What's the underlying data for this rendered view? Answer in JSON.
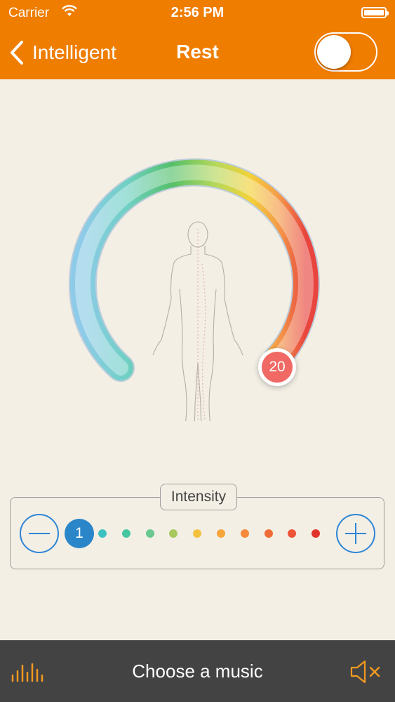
{
  "status_bar": {
    "carrier": "Carrier",
    "time": "2:56 PM"
  },
  "nav": {
    "back_label": "Intelligent",
    "title": "Rest",
    "toggle_on": false,
    "toggle_color": "#ef7d00"
  },
  "dial": {
    "value": "20",
    "handle_color": "#f06964"
  },
  "intensity": {
    "label": "Intensity",
    "selected_level": "1",
    "levels_total": 11,
    "dot_colors": [
      "#2a86c8",
      "#3cc1c0",
      "#46c6a0",
      "#69c890",
      "#a6c85c",
      "#f4c13e",
      "#f7a43a",
      "#f58a3a",
      "#f06b35",
      "#ee5436",
      "#e0342b"
    ]
  },
  "bottom_bar": {
    "music_label": "Choose a music",
    "accent_color": "#f29a1f"
  },
  "icons": {
    "back": "chevron-left-icon",
    "wifi": "wifi-icon",
    "battery": "battery-icon",
    "minus": "minus-icon",
    "plus": "plus-icon",
    "equalizer": "equalizer-icon",
    "mute": "speaker-mute-icon",
    "body": "human-body-icon"
  }
}
